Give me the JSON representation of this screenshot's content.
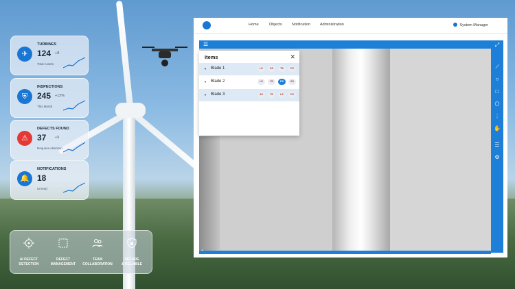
{
  "stats": [
    {
      "title": "TURBINES",
      "value": "124",
      "delta": "+8",
      "sub": "Total Assets",
      "icon": "airplane-icon",
      "accent": "#1976d2"
    },
    {
      "title": "INSPECTIONS",
      "value": "245",
      "delta": "+12%",
      "sub": "This Month",
      "icon": "shield-icon",
      "accent": "#1976d2"
    },
    {
      "title": "DEFECTS FOUND",
      "value": "37",
      "delta": "+5",
      "sub": "Requires Attention",
      "icon": "warning-icon",
      "accent": "#e53935"
    },
    {
      "title": "NOTIFICATIONS",
      "value": "18",
      "delta": "",
      "sub": "Unread",
      "icon": "bell-icon",
      "accent": "#1976d2"
    }
  ],
  "features": [
    {
      "line1": "AI DEFECT",
      "line2": "DETECTION",
      "icon": "crosshair-icon"
    },
    {
      "line1": "DEFECT",
      "line2": "MANAGEMENT",
      "icon": "selection-box-icon"
    },
    {
      "line1": "TEAM",
      "line2": "COLLABORATION",
      "icon": "team-icon"
    },
    {
      "line1": "SECURE",
      "line2": "& RELIABLE",
      "icon": "shield-lock-icon"
    }
  ],
  "nav": {
    "links": [
      "Home",
      "Objects",
      "Notification",
      "Administration"
    ],
    "user": "System Manager"
  },
  "panel": {
    "title": "Items",
    "rows": [
      {
        "label": "Blade 1",
        "tags": [
          "LE",
          "SS",
          "TE",
          "PS"
        ],
        "active": "",
        "highlight": true
      },
      {
        "label": "Blade 2",
        "tags": [
          "LE",
          "TE",
          "PS",
          "SS"
        ],
        "active": "PS",
        "highlight": false
      },
      {
        "label": "Blade 3",
        "tags": [
          "SS",
          "TE",
          "LE",
          "PS"
        ],
        "active": "",
        "highlight": true
      }
    ]
  },
  "colors": {
    "primary": "#1e7fd8",
    "danger": "#e53935"
  }
}
